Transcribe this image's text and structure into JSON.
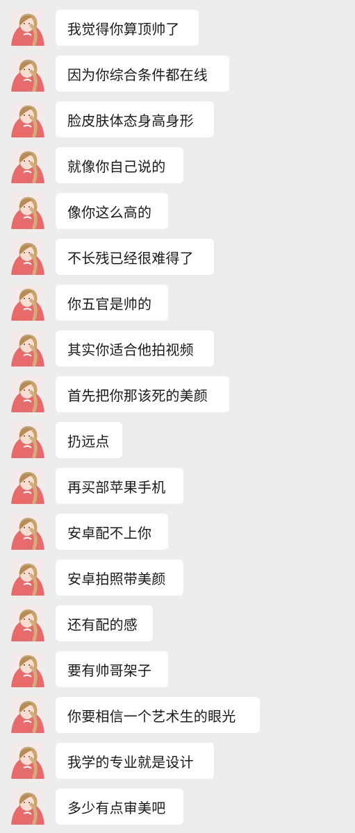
{
  "chat": {
    "messages": [
      {
        "text": "我觉得你算顶帅了",
        "avatar_icon": "profile-avatar-icon"
      },
      {
        "text": "因为你综合条件都在线",
        "avatar_icon": "profile-avatar-icon"
      },
      {
        "text": "脸皮肤体态身高身形",
        "avatar_icon": "profile-avatar-icon"
      },
      {
        "text": "就像你自己说的",
        "avatar_icon": "profile-avatar-icon"
      },
      {
        "text": "像你这么高的",
        "avatar_icon": "profile-avatar-icon"
      },
      {
        "text": "不长残已经很难得了",
        "avatar_icon": "profile-avatar-icon"
      },
      {
        "text": "你五官是帅的",
        "avatar_icon": "profile-avatar-icon"
      },
      {
        "text": "其实你适合他拍视频",
        "avatar_icon": "profile-avatar-icon"
      },
      {
        "text": "首先把你那该死的美颜",
        "avatar_icon": "profile-avatar-icon"
      },
      {
        "text": "扔远点",
        "avatar_icon": "profile-avatar-icon"
      },
      {
        "text": "再买部苹果手机",
        "avatar_icon": "profile-avatar-icon"
      },
      {
        "text": "安卓配不上你",
        "avatar_icon": "profile-avatar-icon"
      },
      {
        "text": "安卓拍照带美颜",
        "avatar_icon": "profile-avatar-icon"
      },
      {
        "text": "还有配的感",
        "avatar_icon": "profile-avatar-icon"
      },
      {
        "text": "要有帅哥架子",
        "avatar_icon": "profile-avatar-icon"
      },
      {
        "text": "你要相信一个艺术生的眼光",
        "avatar_icon": "profile-avatar-icon"
      },
      {
        "text": "我学的专业就是设计",
        "avatar_icon": "profile-avatar-icon"
      },
      {
        "text": "多少有点审美吧",
        "avatar_icon": "profile-avatar-icon"
      }
    ]
  },
  "colors": {
    "background": "#ededed",
    "bubble": "#ffffff",
    "text": "#1a1a1a",
    "avatar_shirt": "#e86b6b",
    "avatar_hair": "#c9a469"
  }
}
